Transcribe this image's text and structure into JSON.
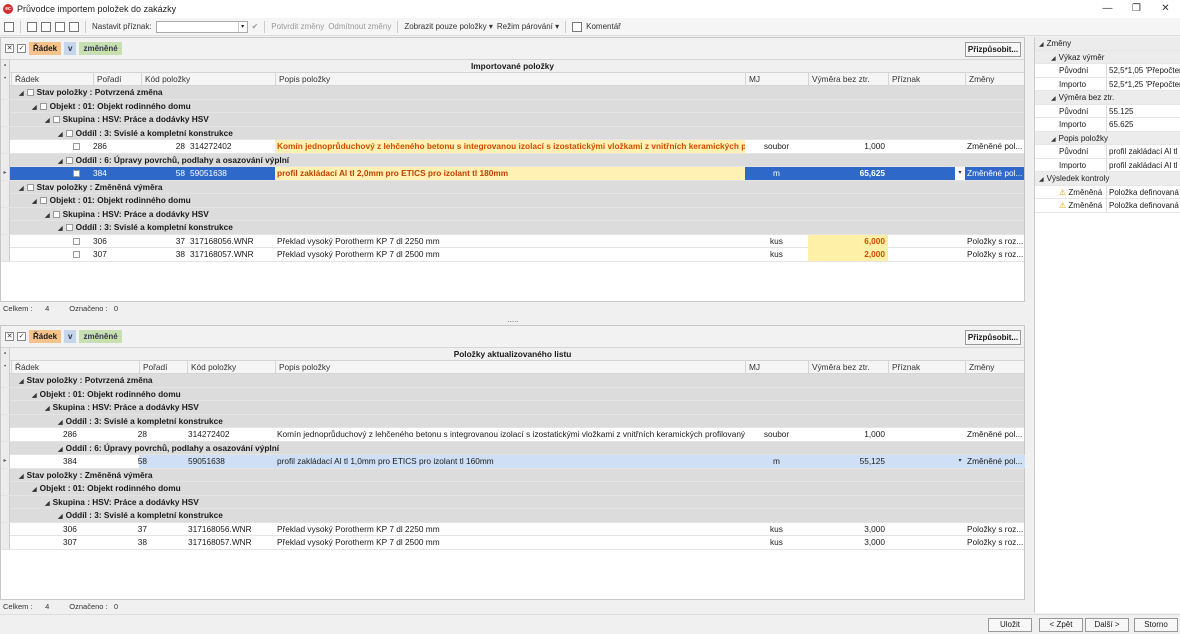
{
  "window": {
    "title": "Průvodce importem položek do zakázky",
    "app_badge": "ec",
    "minimize": "—",
    "maximize": "❐",
    "close": "✕"
  },
  "toolbar": {
    "set_flag_label": "Nastavit příznak:",
    "confirm_changes": "Potvrdit změny",
    "reject_changes": "Odmítnout změny",
    "show_only": "Zobrazit pouze položky",
    "pairing_mode": "Režim párování",
    "comment": "Komentář"
  },
  "filter": {
    "row": "Řádek",
    "v": "v",
    "changed": "změněné",
    "customize": "Přizpůsobit..."
  },
  "top_grid": {
    "title": "Importované položky",
    "columns": [
      "Řádek",
      "Pořadí",
      "Kód položky",
      "Popis položky",
      "MJ",
      "Výměra bez ztr.",
      "Příznak",
      "Změny"
    ],
    "rows": [
      {
        "kind": "g0",
        "text": "Stav položky : Potvrzená změna"
      },
      {
        "kind": "g1",
        "text": "Objekt : 01: Objekt rodinného domu"
      },
      {
        "kind": "g2",
        "text": "Skupina : HSV: Práce a dodávky HSV"
      },
      {
        "kind": "g3",
        "text": "Oddíl : 3: Svislé a kompletní konstrukce"
      },
      {
        "kind": "d",
        "row": "286",
        "order": "28",
        "code": "314272402",
        "desc": "Komín jednoprůduchový z lehčeného betonu s integrovanou izolací s izostatickými vložkami z vnitřních keramických prof...",
        "mj": "soubor",
        "qty": "1,000",
        "changes": "Změněné pol...",
        "style": "desc-orange"
      },
      {
        "kind": "g3",
        "text": "Oddíl : 6: Úpravy povrchů, podlahy a osazování výplní"
      },
      {
        "kind": "d",
        "row": "384",
        "order": "58",
        "code": "59051638",
        "desc": "profil zakládací Al tl 2,0mm pro ETICS pro izolant tl 180mm",
        "mj": "m",
        "qty": "65,625",
        "changes": "Změněné pol...",
        "style": "selected"
      },
      {
        "kind": "g0",
        "text": "Stav položky : Změněná výměra"
      },
      {
        "kind": "g1",
        "text": "Objekt : 01: Objekt rodinného domu"
      },
      {
        "kind": "g2",
        "text": "Skupina : HSV: Práce a dodávky HSV"
      },
      {
        "kind": "g3",
        "text": "Oddíl : 3: Svislé a kompletní konstrukce"
      },
      {
        "kind": "d",
        "row": "306",
        "order": "37",
        "code": "317168056.WNR",
        "desc": "Překlad vysoký Porotherm KP 7 dl 2250 mm",
        "mj": "kus",
        "qty": "6,000",
        "changes": "Položky s roz...",
        "style": "qty-hl"
      },
      {
        "kind": "d",
        "row": "307",
        "order": "38",
        "code": "317168057.WNR",
        "desc": "Překlad vysoký Porotherm KP 7 dl 2500 mm",
        "mj": "kus",
        "qty": "2,000",
        "changes": "Položky s roz...",
        "style": "qty-hl"
      }
    ],
    "footer_total_label": "Celkem :",
    "footer_total": "4",
    "footer_marked_label": "Označeno :",
    "footer_marked": "0"
  },
  "splitter": ".....",
  "bottom_grid": {
    "title": "Položky aktualizovaného listu",
    "columns": [
      "Řádek",
      "Pořadí",
      "Kód položky",
      "Popis položky",
      "MJ",
      "Výměra bez ztr.",
      "Příznak",
      "Změny"
    ],
    "rows": [
      {
        "kind": "g0",
        "text": "Stav položky : Potvrzená změna"
      },
      {
        "kind": "g1",
        "text": "Objekt : 01: Objekt rodinného domu"
      },
      {
        "kind": "g2",
        "text": "Skupina : HSV: Práce a dodávky HSV"
      },
      {
        "kind": "g3",
        "text": "Oddíl : 3: Svislé a kompletní konstrukce"
      },
      {
        "kind": "d",
        "row": "286",
        "order": "28",
        "code": "314272402",
        "desc": "Komín jednoprůduchový z lehčeného betonu s integrovanou izolací s izostatickými vložkami z vnitřních keramických profilovaných ...",
        "mj": "soubor",
        "qty": "1,000",
        "changes": "Změněné pol...",
        "style": "plain"
      },
      {
        "kind": "g3",
        "text": "Oddíl : 6: Úpravy povrchů, podlahy a osazování výplní"
      },
      {
        "kind": "d",
        "row": "384",
        "order": "58",
        "code": "59051638",
        "desc": "profil zakládací Al tl 1,0mm pro ETICS pro izolant tl 160mm",
        "mj": "m",
        "qty": "55,125",
        "changes": "Změněné pol...",
        "style": "selected-light"
      },
      {
        "kind": "g0",
        "text": "Stav položky : Změněná výměra"
      },
      {
        "kind": "g1",
        "text": "Objekt : 01: Objekt rodinného domu"
      },
      {
        "kind": "g2",
        "text": "Skupina : HSV: Práce a dodávky HSV"
      },
      {
        "kind": "g3",
        "text": "Oddíl : 3: Svislé a kompletní konstrukce"
      },
      {
        "kind": "d",
        "row": "306",
        "order": "37",
        "code": "317168056.WNR",
        "desc": "Překlad vysoký Porotherm KP 7 dl 2250 mm",
        "mj": "kus",
        "qty": "3,000",
        "changes": "Položky s roz...",
        "style": "plain"
      },
      {
        "kind": "d",
        "row": "307",
        "order": "38",
        "code": "317168057.WNR",
        "desc": "Překlad vysoký Porotherm KP 7 dl 2500 mm",
        "mj": "kus",
        "qty": "3,000",
        "changes": "Položky s roz...",
        "style": "plain"
      }
    ],
    "footer_total_label": "Celkem :",
    "footer_total": "4",
    "footer_marked_label": "Označeno :",
    "footer_marked": "0"
  },
  "properties": [
    {
      "level": 0,
      "key": "Změny",
      "cat": true
    },
    {
      "level": 1,
      "key": "Výkaz výměr",
      "cat": true
    },
    {
      "level": 2,
      "key": "Původní",
      "value": "52,5*1,05 'Přepočten"
    },
    {
      "level": 2,
      "key": "Importo",
      "value": "52,5*1,25 'Přepočten"
    },
    {
      "level": 1,
      "key": "Výměra bez ztr.",
      "cat": true
    },
    {
      "level": 2,
      "key": "Původní",
      "value": "55.125"
    },
    {
      "level": 2,
      "key": "Importo",
      "value": "65.625"
    },
    {
      "level": 1,
      "key": "Popis položky",
      "cat": true
    },
    {
      "level": 2,
      "key": "Původní",
      "value": "profil zakládací Al tl"
    },
    {
      "level": 2,
      "key": "Importo",
      "value": "profil zakládací Al tl"
    },
    {
      "level": 0,
      "key": "Výsledek kontroly",
      "cat": true
    },
    {
      "level": 2,
      "key": "Změněná",
      "value": "Položka definovaná",
      "warn": true
    },
    {
      "level": 2,
      "key": "Změněná",
      "value": "Položka definovaná",
      "warn": true
    }
  ],
  "buttons": {
    "save": "Uložit",
    "back": "< Zpět",
    "next": "Další >",
    "cancel": "Storno"
  }
}
